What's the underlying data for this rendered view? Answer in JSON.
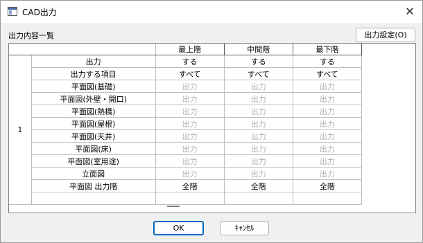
{
  "window": {
    "title": "CAD出力",
    "close_icon": "close-icon"
  },
  "section_label": "出力内容一覧",
  "settings_button": "出力設定(O)",
  "grid": {
    "columns": [
      "最上階",
      "中間階",
      "最下階"
    ],
    "group_label": "1",
    "rows": [
      {
        "label": "出力",
        "values": [
          "する",
          "する",
          "する"
        ],
        "enabled": true
      },
      {
        "label": "出力する項目",
        "values": [
          "すべて",
          "すべて",
          "すべて"
        ],
        "enabled": true
      },
      {
        "label": "平面図(基礎)",
        "values": [
          "出力",
          "出力",
          "出力"
        ],
        "enabled": false
      },
      {
        "label": "平面図(外壁・開口)",
        "values": [
          "出力",
          "出力",
          "出力"
        ],
        "enabled": false
      },
      {
        "label": "平面図(熱橋)",
        "values": [
          "出力",
          "出力",
          "出力"
        ],
        "enabled": false
      },
      {
        "label": "平面図(屋根)",
        "values": [
          "出力",
          "出力",
          "出力"
        ],
        "enabled": false
      },
      {
        "label": "平面図(天井)",
        "values": [
          "出力",
          "出力",
          "出力"
        ],
        "enabled": false
      },
      {
        "label": "平面図(床)",
        "values": [
          "出力",
          "出力",
          "出力"
        ],
        "enabled": false
      },
      {
        "label": "平面図(室用途)",
        "values": [
          "出力",
          "出力",
          "出力"
        ],
        "enabled": false
      },
      {
        "label": "立面図",
        "values": [
          "出力",
          "出力",
          "出力"
        ],
        "enabled": false
      },
      {
        "label": "平面図 出力階",
        "values": [
          "全階",
          "全階",
          "全階"
        ],
        "enabled": true
      }
    ]
  },
  "buttons": {
    "ok": "OK",
    "cancel": "ｷｬﾝｾﾙ"
  }
}
